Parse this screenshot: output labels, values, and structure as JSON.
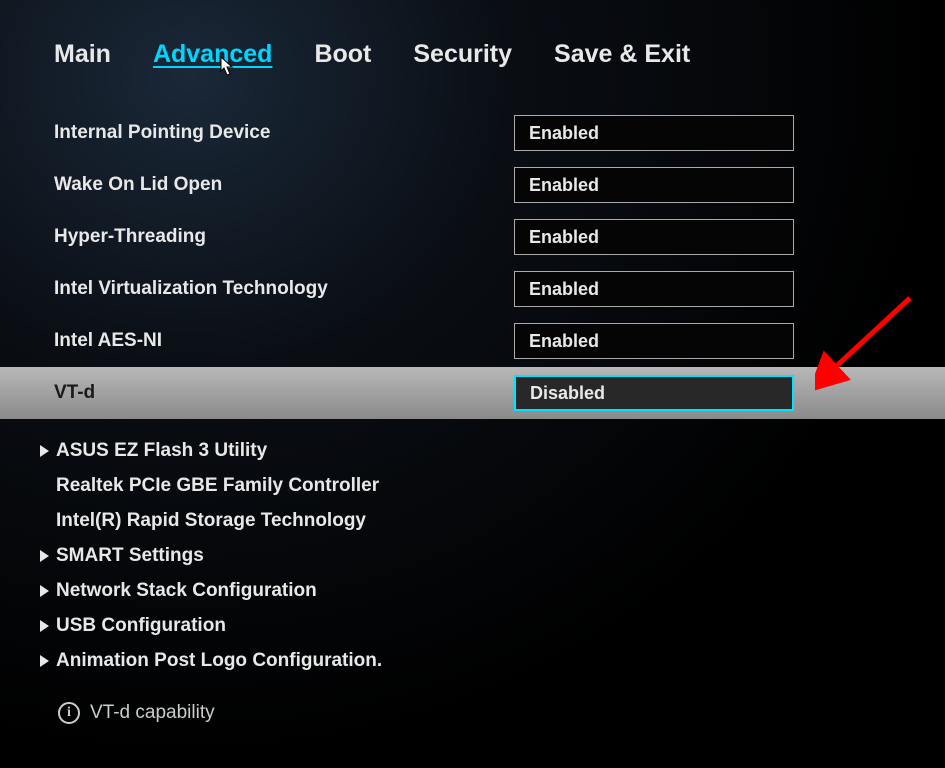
{
  "tabs": {
    "main": "Main",
    "advanced": "Advanced",
    "boot": "Boot",
    "security": "Security",
    "save_exit": "Save & Exit"
  },
  "settings": {
    "internal_pointing_device": {
      "label": "Internal Pointing Device",
      "value": "Enabled"
    },
    "wake_on_lid_open": {
      "label": "Wake On Lid Open",
      "value": "Enabled"
    },
    "hyper_threading": {
      "label": "Hyper-Threading",
      "value": "Enabled"
    },
    "intel_virtualization": {
      "label": "Intel Virtualization Technology",
      "value": "Enabled"
    },
    "intel_aes_ni": {
      "label": "Intel AES-NI",
      "value": "Enabled"
    },
    "vt_d": {
      "label": "VT-d",
      "value": "Disabled"
    }
  },
  "submenus": {
    "asus_ez_flash": "ASUS EZ Flash 3 Utility",
    "realtek_pcie": "Realtek PCIe GBE Family Controller",
    "intel_rapid_storage": "Intel(R) Rapid Storage Technology",
    "smart_settings": "SMART Settings",
    "network_stack": "Network Stack Configuration",
    "usb_config": "USB Configuration",
    "animation_post_logo": "Animation Post Logo Configuration."
  },
  "help": {
    "text": "VT-d capability"
  }
}
